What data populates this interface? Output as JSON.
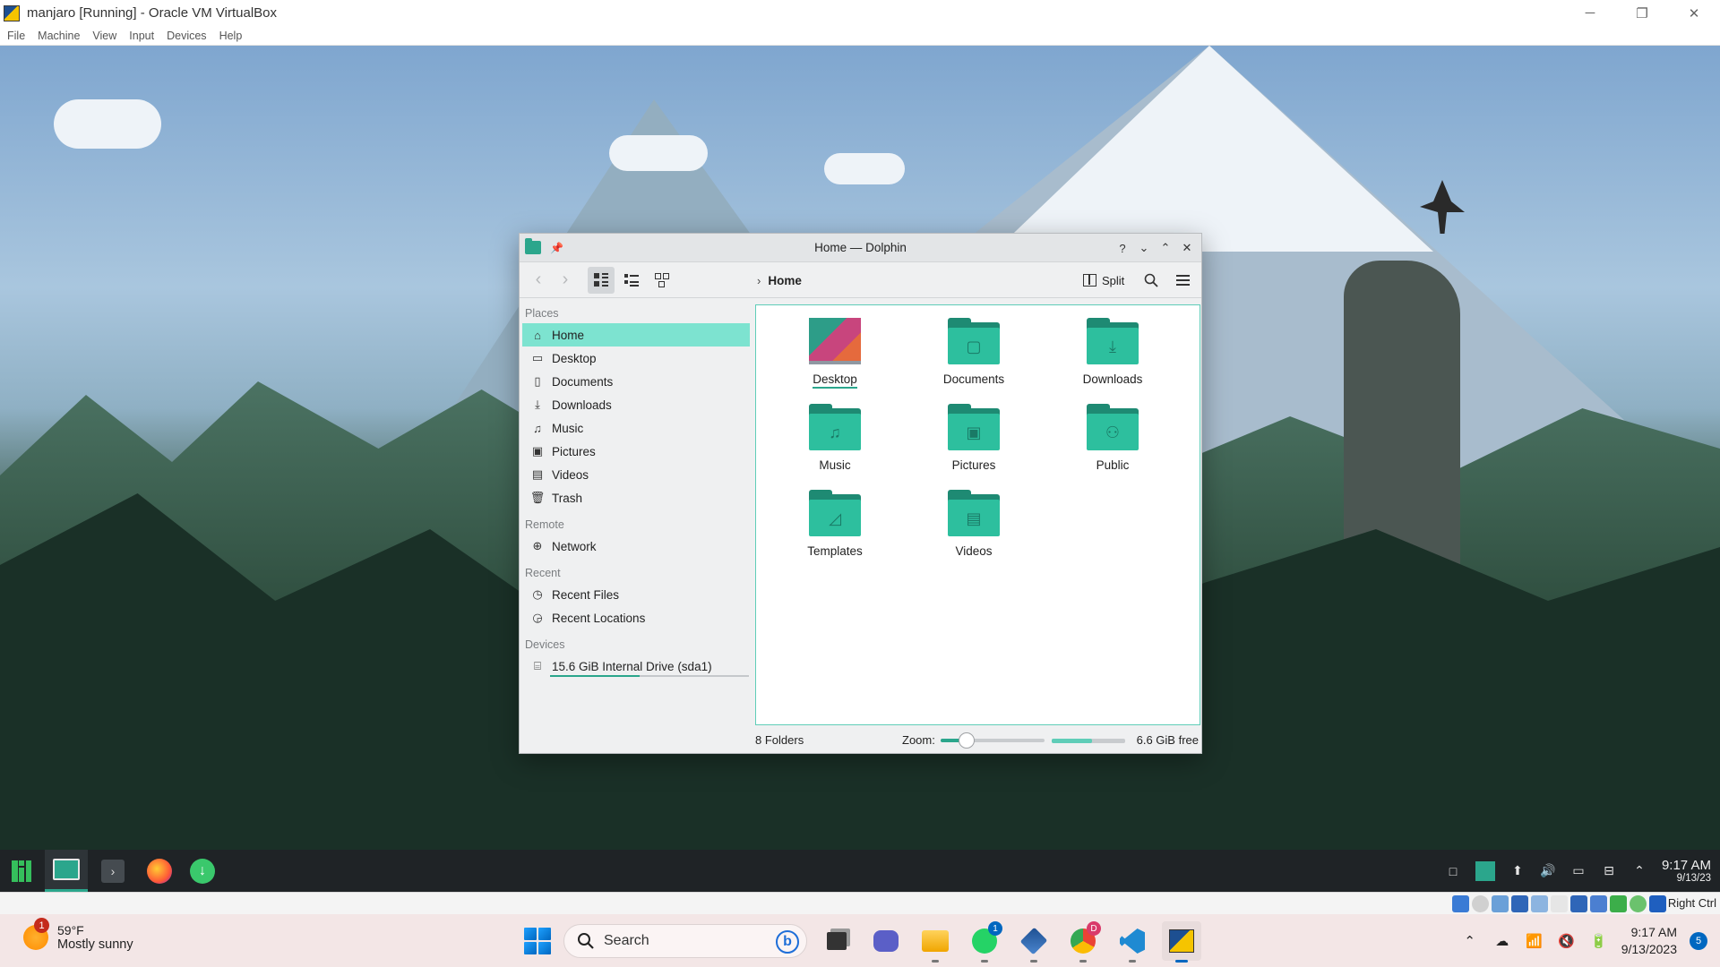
{
  "host_window": {
    "title": "manjaro [Running] - Oracle VM VirtualBox",
    "menu": [
      "File",
      "Machine",
      "View",
      "Input",
      "Devices",
      "Help"
    ],
    "controls": {
      "minimize": "─",
      "restore": "❐",
      "close": "✕"
    }
  },
  "dolphin": {
    "title": "Home — Dolphin",
    "title_buttons": {
      "help": "?",
      "shade": "⌄",
      "maximize": "⌃",
      "close": "✕"
    },
    "toolbar": {
      "back": "‹",
      "forward": "›",
      "breadcrumb_chevron": "›",
      "breadcrumb": "Home",
      "split_label": "Split"
    },
    "places": {
      "sections": [
        {
          "title": "Places",
          "items": [
            {
              "label": "Home",
              "icon": "home-icon"
            },
            {
              "label": "Desktop",
              "icon": "desktop-icon"
            },
            {
              "label": "Documents",
              "icon": "documents-icon"
            },
            {
              "label": "Downloads",
              "icon": "downloads-icon"
            },
            {
              "label": "Music",
              "icon": "music-icon"
            },
            {
              "label": "Pictures",
              "icon": "pictures-icon"
            },
            {
              "label": "Videos",
              "icon": "videos-icon"
            },
            {
              "label": "Trash",
              "icon": "trash-icon"
            }
          ]
        },
        {
          "title": "Remote",
          "items": [
            {
              "label": "Network",
              "icon": "network-icon"
            }
          ]
        },
        {
          "title": "Recent",
          "items": [
            {
              "label": "Recent Files",
              "icon": "recent-files-icon"
            },
            {
              "label": "Recent Locations",
              "icon": "recent-locations-icon"
            }
          ]
        },
        {
          "title": "Devices",
          "items": [
            {
              "label": "15.6 GiB Internal Drive (sda1)",
              "icon": "drive-icon"
            }
          ]
        }
      ],
      "active_item": "Home",
      "drive_usage_fraction": 0.45
    },
    "files": [
      {
        "name": "Desktop",
        "icon": "desktop-folder-icon"
      },
      {
        "name": "Documents",
        "icon": "documents-folder-icon"
      },
      {
        "name": "Downloads",
        "icon": "downloads-folder-icon"
      },
      {
        "name": "Music",
        "icon": "music-folder-icon"
      },
      {
        "name": "Pictures",
        "icon": "pictures-folder-icon"
      },
      {
        "name": "Public",
        "icon": "public-folder-icon"
      },
      {
        "name": "Templates",
        "icon": "templates-folder-icon"
      },
      {
        "name": "Videos",
        "icon": "videos-folder-icon"
      }
    ],
    "status": {
      "count": "8 Folders",
      "zoom_label": "Zoom:",
      "zoom_fraction": 0.25,
      "disk_used_fraction": 0.55,
      "free": "6.6 GiB free"
    }
  },
  "guest_panel": {
    "time": "9:17 AM",
    "date": "9/13/23"
  },
  "vbox_status": {
    "host_key": "Right Ctrl"
  },
  "windows_taskbar": {
    "weather": {
      "temp": "59°F",
      "condition": "Mostly sunny",
      "badge": "1"
    },
    "search_label": "Search",
    "whatsapp_badge": "1",
    "chrome_badge": "D",
    "time": "9:17 AM",
    "date": "9/13/2023",
    "notification_count": "5"
  },
  "colors": {
    "accent": "#2ba68c",
    "selection": "#7de3d0",
    "folder": "#2dbf9e"
  }
}
